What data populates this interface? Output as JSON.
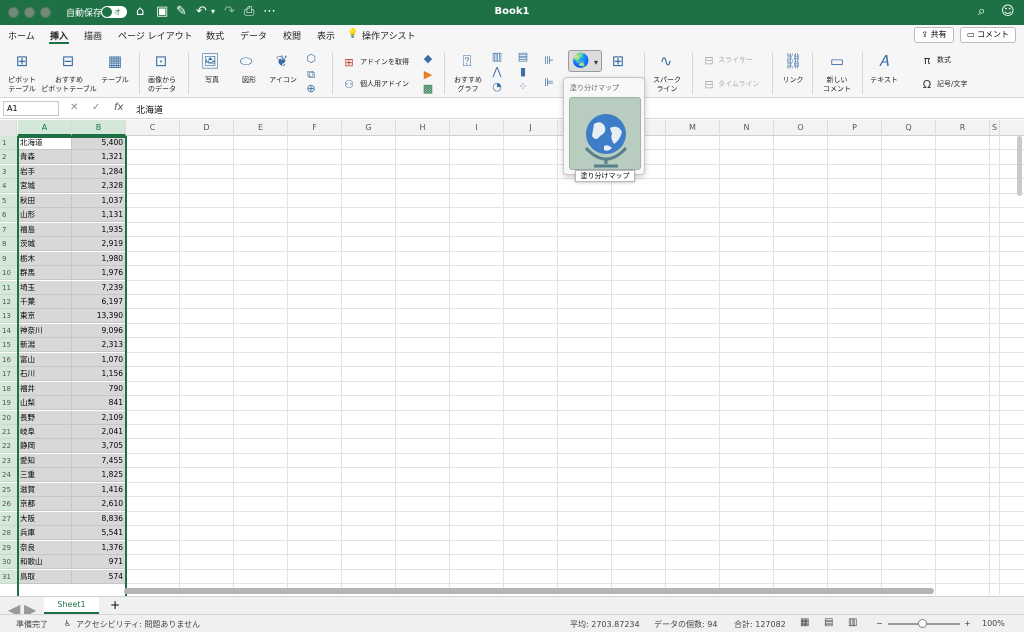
{
  "window": {
    "title": "Book1",
    "autosave_label": "自動保存",
    "autosave_state": "オフ",
    "titlebar_color": "#1e7145"
  },
  "tabs": [
    "ホーム",
    "挿入",
    "描画",
    "ページ レイアウト",
    "数式",
    "データ",
    "校閲",
    "表示"
  ],
  "active_tab": "挿入",
  "tell_me": "操作アシスト",
  "share_label": "共有",
  "comment_label": "コメント",
  "ribbon": {
    "pivot_table": "ピボット\nテーブル",
    "recommended_pivot": "おすすめ\nピボットテーブル",
    "table": "テーブル",
    "data_from_picture": "画像から\nのデータ",
    "pictures": "写真",
    "shapes": "図形",
    "icons": "アイコン",
    "get_addins": "アドインを取得",
    "my_addins": "個人用アドイン",
    "recommended_charts": "おすすめ\nグラフ",
    "sparklines": "スパーク\nライン",
    "slicer": "スライサー",
    "timeline": "タイムライン",
    "link": "リンク",
    "new_comment": "新しい\nコメント",
    "text": "テキスト",
    "equation": "数式",
    "symbol": "記号/文字"
  },
  "formula_bar": {
    "name_box": "A1",
    "fx": "fx",
    "value": "北海道"
  },
  "columns": [
    "A",
    "B",
    "C",
    "D",
    "E",
    "F",
    "G",
    "H",
    "I",
    "J",
    "K",
    "L",
    "M",
    "N",
    "O",
    "P",
    "Q",
    "R",
    "S"
  ],
  "rows": [
    {
      "n": "1",
      "a": "北海道",
      "b": "5,400"
    },
    {
      "n": "2",
      "a": "青森",
      "b": "1,321"
    },
    {
      "n": "3",
      "a": "岩手",
      "b": "1,284"
    },
    {
      "n": "4",
      "a": "宮城",
      "b": "2,328"
    },
    {
      "n": "5",
      "a": "秋田",
      "b": "1,037"
    },
    {
      "n": "6",
      "a": "山形",
      "b": "1,131"
    },
    {
      "n": "7",
      "a": "福島",
      "b": "1,935"
    },
    {
      "n": "8",
      "a": "茨城",
      "b": "2,919"
    },
    {
      "n": "9",
      "a": "栃木",
      "b": "1,980"
    },
    {
      "n": "10",
      "a": "群馬",
      "b": "1,976"
    },
    {
      "n": "11",
      "a": "埼玉",
      "b": "7,239"
    },
    {
      "n": "12",
      "a": "千葉",
      "b": "6,197"
    },
    {
      "n": "13",
      "a": "東京",
      "b": "13,390"
    },
    {
      "n": "14",
      "a": "神奈川",
      "b": "9,096"
    },
    {
      "n": "15",
      "a": "新潟",
      "b": "2,313"
    },
    {
      "n": "16",
      "a": "富山",
      "b": "1,070"
    },
    {
      "n": "17",
      "a": "石川",
      "b": "1,156"
    },
    {
      "n": "18",
      "a": "福井",
      "b": "790"
    },
    {
      "n": "19",
      "a": "山梨",
      "b": "841"
    },
    {
      "n": "20",
      "a": "長野",
      "b": "2,109"
    },
    {
      "n": "21",
      "a": "岐阜",
      "b": "2,041"
    },
    {
      "n": "22",
      "a": "静岡",
      "b": "3,705"
    },
    {
      "n": "23",
      "a": "愛知",
      "b": "7,455"
    },
    {
      "n": "24",
      "a": "三重",
      "b": "1,825"
    },
    {
      "n": "25",
      "a": "滋賀",
      "b": "1,416"
    },
    {
      "n": "26",
      "a": "京都",
      "b": "2,610"
    },
    {
      "n": "27",
      "a": "大阪",
      "b": "8,836"
    },
    {
      "n": "28",
      "a": "兵庫",
      "b": "5,541"
    },
    {
      "n": "29",
      "a": "奈良",
      "b": "1,376"
    },
    {
      "n": "30",
      "a": "和歌山",
      "b": "971"
    },
    {
      "n": "31",
      "a": "鳥取",
      "b": "574"
    }
  ],
  "dropdown": {
    "header": "塗り分けマップ",
    "tooltip": "塗り分けマップ"
  },
  "sheet_tab": "Sheet1",
  "status": {
    "ready": "準備完了",
    "accessibility": "アクセシビリティ: 問題ありません",
    "average": "平均: 2703.87234",
    "count": "データの個数: 94",
    "sum": "合計: 127082",
    "zoom": "100%"
  }
}
